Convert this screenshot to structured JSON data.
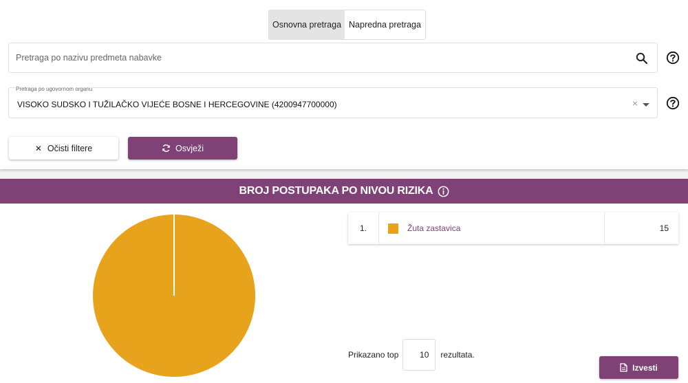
{
  "tabs": [
    {
      "label": "Osnovna pretraga",
      "active": true
    },
    {
      "label": "Napredna pretraga",
      "active": false
    }
  ],
  "search": {
    "placeholder": "Pretraga po nazivu predmeta nabavke",
    "value": ""
  },
  "authority_select": {
    "label": "Pretraga po ugovornom organu",
    "value": "VISOKO SUDSKO I TUŽILAČKO VIJEĆE BOSNE I HERCEGOVINE (4200947700000)",
    "clear_glyph": "×"
  },
  "buttons": {
    "clear": "Očisti filtere",
    "refresh": "Osvježi",
    "report": "Izvesti"
  },
  "section": {
    "title": "BROJ POSTUPAKA PO NIVOU RIZIKA"
  },
  "legend": {
    "rows": [
      {
        "index": "1.",
        "label": "Žuta zastavica",
        "value": "15",
        "color": "#e8a31d"
      }
    ]
  },
  "topn": {
    "prefix": "Prikazano top",
    "value": "10",
    "suffix": "rezultata."
  },
  "colors": {
    "accent": "#7f4277",
    "yellow_flag": "#e8a31d"
  },
  "icons": [
    "search-icon",
    "help-icon",
    "close-icon",
    "caret-down-icon",
    "refresh-icon",
    "info-icon",
    "document-icon"
  ],
  "chart_data": {
    "type": "pie",
    "categories": [
      "Žuta zastavica"
    ],
    "values": [
      15
    ],
    "colors": [
      "#e8a31d"
    ]
  }
}
